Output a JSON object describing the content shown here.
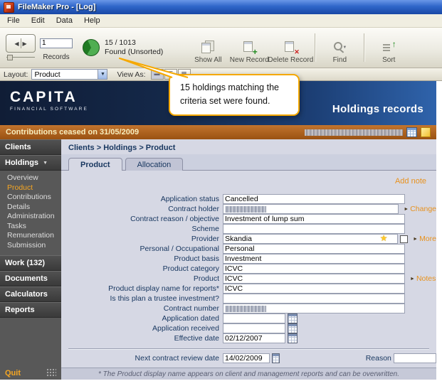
{
  "window": {
    "title": "FileMaker Pro - [Log]"
  },
  "menu": {
    "items": [
      "File",
      "Edit",
      "Data",
      "Help"
    ]
  },
  "toolbar": {
    "record_number": "1",
    "records_label": "Records",
    "found_count": "15 / 1013",
    "found_status": "Found (Unsorted)",
    "buttons": [
      {
        "label": "Show All"
      },
      {
        "label": "New Record"
      },
      {
        "label": "Delete Record"
      },
      {
        "label": "Find"
      },
      {
        "label": "Sort"
      }
    ]
  },
  "layout_bar": {
    "layout_label": "Layout:",
    "layout_value": "Product",
    "view_as_label": "View As:"
  },
  "callout": {
    "text": "15 holdings matching the criteria set were found."
  },
  "header": {
    "brand": "CAPITA",
    "brand_sub": "FINANCIAL SOFTWARE",
    "title": "Holdings records"
  },
  "status_bar": {
    "message": "Contributions ceased on 31/05/2009"
  },
  "sidebar": {
    "clients_label": "Clients",
    "holdings_label": "Holdings",
    "holdings_items": [
      "Overview",
      "Product",
      "Contributions",
      "Details",
      "Administration",
      "Tasks",
      "Remuneration",
      "Submission"
    ],
    "active_item": "Product",
    "sections": [
      "Work (132)",
      "Documents",
      "Calculators",
      "Reports"
    ],
    "quit_label": "Quit"
  },
  "main": {
    "breadcrumb": "Clients > Holdings > Product",
    "tabs": [
      {
        "label": "Product",
        "active": true
      },
      {
        "label": "Allocation",
        "active": false
      }
    ],
    "add_note_label": "Add note",
    "fields": [
      {
        "label": "Application status",
        "value": "Cancelled"
      },
      {
        "label": "Contract holder",
        "value": "",
        "redacted": true,
        "link": "Change"
      },
      {
        "label": "Contract reason / objective",
        "value": "Investment of lump sum"
      },
      {
        "label": "Scheme",
        "value": ""
      },
      {
        "label": "Provider",
        "value": "Skandia",
        "star": true,
        "checkbox": true,
        "link": "More"
      },
      {
        "label": "Personal / Occupational",
        "value": "Personal"
      },
      {
        "label": "Product basis",
        "value": "Investment"
      },
      {
        "label": "Product category",
        "value": "ICVC"
      },
      {
        "label": "Product",
        "value": "ICVC",
        "link": "Notes"
      },
      {
        "label": "Product display name for reports*",
        "value": "ICVC"
      },
      {
        "label": "Is this plan a trustee investment?",
        "value": ""
      },
      {
        "label": "Contract number",
        "value": "",
        "redacted": true
      },
      {
        "label": "Application dated",
        "value": "",
        "date": true,
        "calendar": true
      },
      {
        "label": "Application received",
        "value": "",
        "date": true,
        "calendar": true
      },
      {
        "label": "Effective date",
        "value": "02/12/2007",
        "date": true,
        "calendar": true
      }
    ],
    "review_row": {
      "label": "Next contract review date",
      "value": "14/02/2009",
      "reason_label": "Reason",
      "reason_value": ""
    },
    "footnote": "* The Product display name appears on client and management reports and can be overwritten."
  },
  "colors": {
    "accent_orange": "#f5a623",
    "header_navy": "#142849",
    "status_orange": "#a85a1a",
    "callout_border": "#f5a800"
  }
}
